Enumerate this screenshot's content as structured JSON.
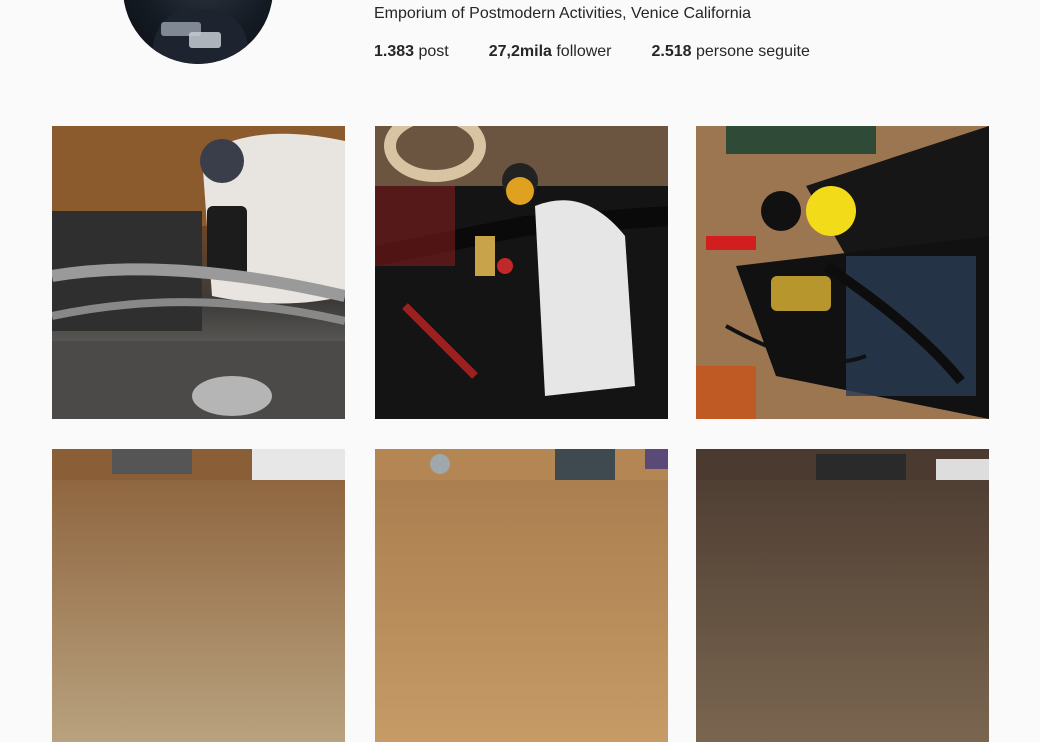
{
  "profile": {
    "bio": "Emporium of Postmodern Activities, Venice California",
    "stats": [
      {
        "count": "1.383",
        "label": "post"
      },
      {
        "count": "27,2mila",
        "label": "follower"
      },
      {
        "count": "2.518",
        "label": "persone seguite"
      }
    ]
  },
  "posts": [
    {
      "icon": "photo-workshop-tank"
    },
    {
      "icon": "photo-motorcycle-controls"
    },
    {
      "icon": "photo-brake-lever-box"
    },
    {
      "icon": "photo-workshop"
    },
    {
      "icon": "photo-workshop-bench"
    },
    {
      "icon": "photo-workshop-tools"
    }
  ]
}
